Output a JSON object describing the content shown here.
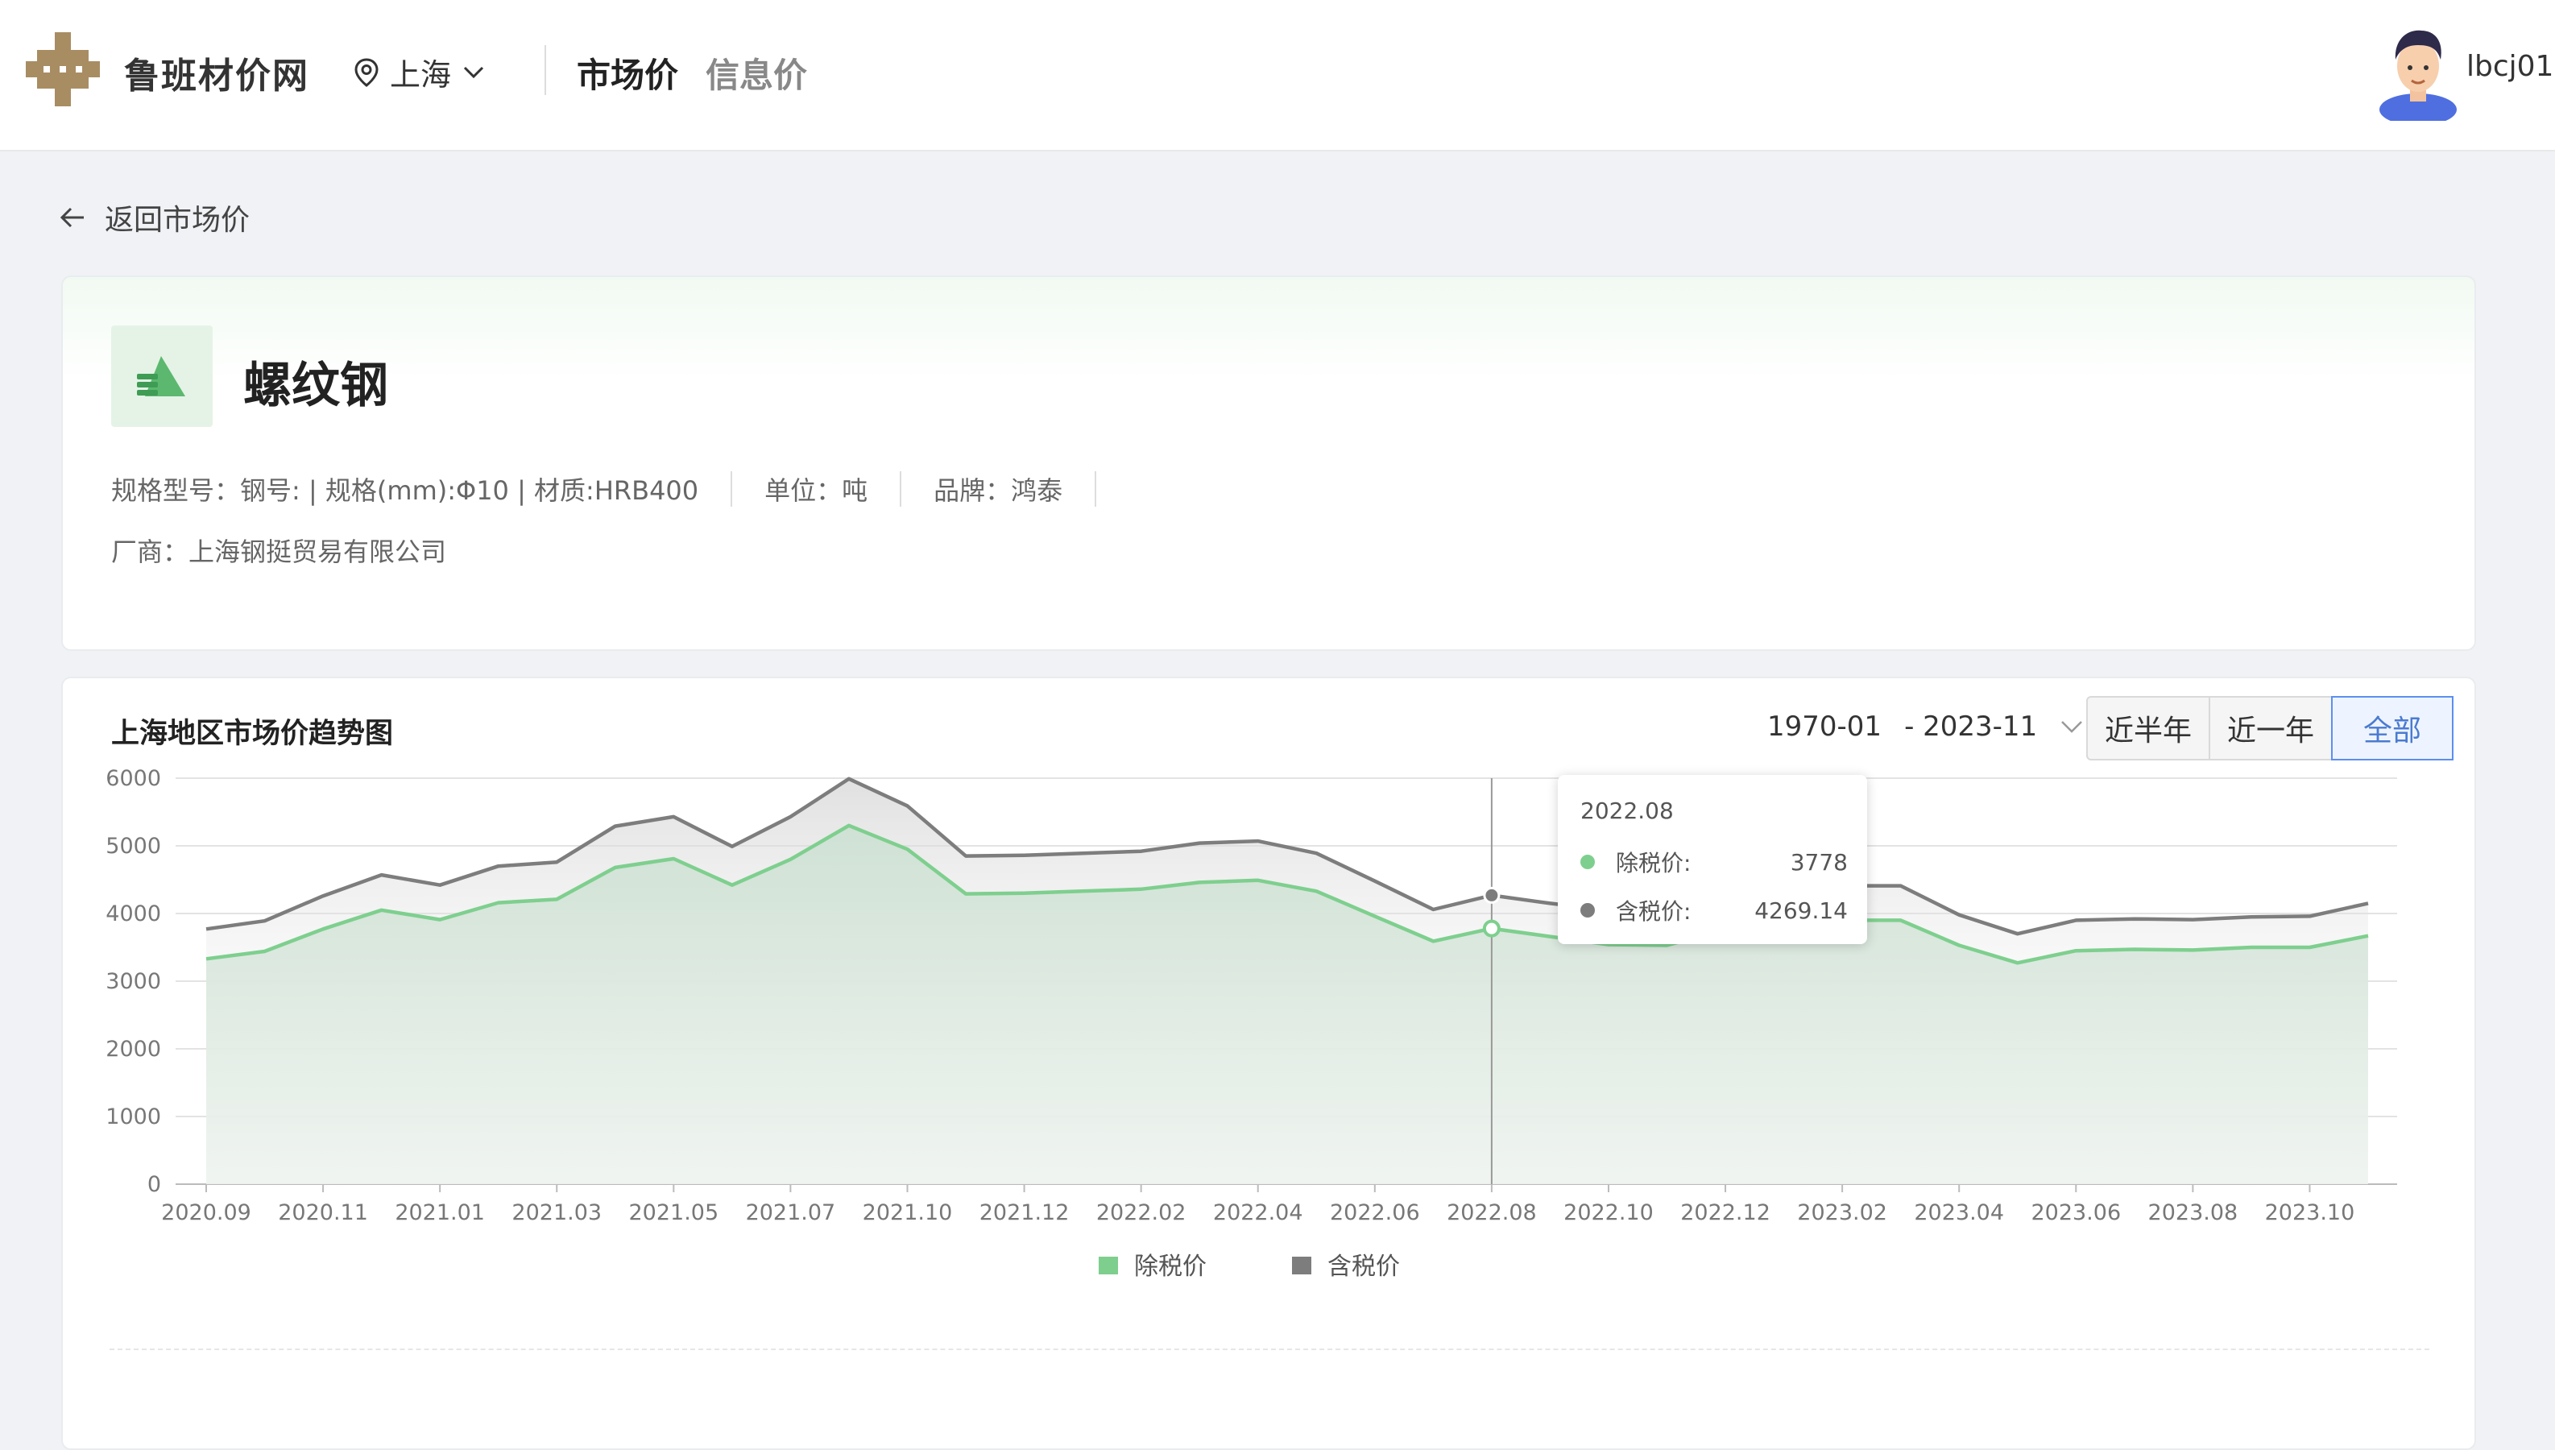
{
  "header": {
    "brand": "鲁班材价网",
    "location": "上海",
    "nav_active": "市场价",
    "nav_inactive": "信息价",
    "username": "lbcj01"
  },
  "back_label": "返回市场价",
  "product": {
    "name": "螺纹钢",
    "spec": "规格型号：钢号: | 规格(mm):Φ10 | 材质:HRB400",
    "unit": "单位：吨",
    "brand": "品牌：鸿泰",
    "vendor": "厂商：上海钢挺贸易有限公司"
  },
  "chart_panel": {
    "title": "上海地区市场价趋势图",
    "date_start": "1970-01",
    "date_end": "- 2023-11",
    "buttons": [
      "近半年",
      "近一年",
      "全部"
    ],
    "active_button": "全部"
  },
  "tooltip": {
    "title": "2022.08",
    "rows": [
      {
        "label": "除税价:",
        "value": "3778"
      },
      {
        "label": "含税价:",
        "value": "4269.14"
      }
    ]
  },
  "colors": {
    "ex_tax": "#7ecf8e",
    "inc_tax": "#7d7d7d",
    "accent": "#5b8ff0"
  },
  "chart_data": {
    "type": "area",
    "title": "",
    "ylim": [
      0,
      6000
    ],
    "yticks": [
      0,
      1000,
      2000,
      3000,
      4000,
      5000,
      6000
    ],
    "x": [
      "2020.09",
      "2020.10",
      "2020.11",
      "2020.12",
      "2021.01",
      "2021.02",
      "2021.03",
      "2021.04",
      "2021.05",
      "2021.06",
      "2021.07",
      "2021.08",
      "2021.10",
      "2021.11",
      "2021.12",
      "2022.01",
      "2022.02",
      "2022.03",
      "2022.04",
      "2022.05",
      "2022.06",
      "2022.07",
      "2022.08",
      "2022.09",
      "2022.10",
      "2022.11",
      "2022.12",
      "2023.01",
      "2023.02",
      "2023.03",
      "2023.04",
      "2023.05",
      "2023.06",
      "2023.07",
      "2023.08",
      "2023.09",
      "2023.10",
      "2023.11"
    ],
    "xtick_labels": [
      "2020.09",
      "2020.11",
      "2021.01",
      "2021.03",
      "2021.05",
      "2021.07",
      "2021.10",
      "2021.12",
      "2022.02",
      "2022.04",
      "2022.06",
      "2022.08",
      "2022.10",
      "2022.12",
      "2023.02",
      "2023.04",
      "2023.06",
      "2023.08",
      "2023.10"
    ],
    "series": [
      {
        "name": "除税价",
        "values": [
          3330,
          3440,
          3770,
          4050,
          3910,
          4160,
          4210,
          4680,
          4810,
          4420,
          4800,
          5300,
          4950,
          4290,
          4300,
          4330,
          4360,
          4460,
          4490,
          4330,
          3960,
          3590,
          3778,
          3660,
          3540,
          3530,
          3760,
          3900,
          3900,
          3900,
          3530,
          3270,
          3450,
          3470,
          3460,
          3500,
          3500,
          3670
        ]
      },
      {
        "name": "含税价",
        "values": [
          3770,
          3890,
          4260,
          4570,
          4420,
          4700,
          4760,
          5290,
          5430,
          4990,
          5430,
          5990,
          5590,
          4850,
          4860,
          4890,
          4920,
          5040,
          5070,
          4890,
          4480,
          4060,
          4269.14,
          4150,
          4050,
          4060,
          4250,
          4400,
          4410,
          4410,
          3980,
          3700,
          3900,
          3920,
          3910,
          3950,
          3960,
          4150
        ]
      }
    ],
    "highlight_index": 22,
    "legend_position": "bottom-center",
    "grid": true
  }
}
